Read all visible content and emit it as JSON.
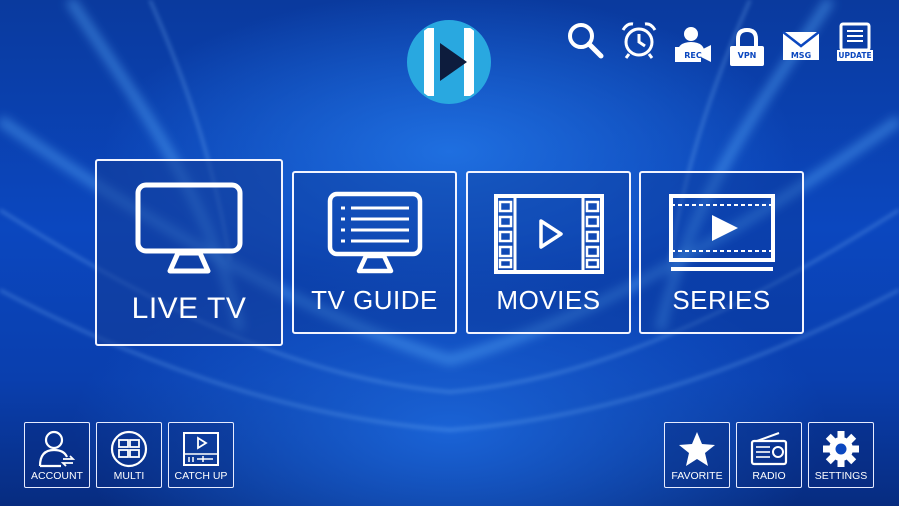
{
  "top_bar": {
    "icons": [
      {
        "name": "search-icon",
        "label": ""
      },
      {
        "name": "alarm-clock-icon",
        "label": ""
      },
      {
        "name": "record-icon",
        "label": "REC"
      },
      {
        "name": "vpn-icon",
        "label": "VPN"
      },
      {
        "name": "message-icon",
        "label": "MSG"
      },
      {
        "name": "update-icon",
        "label": "UPDATE"
      }
    ]
  },
  "main_menu": {
    "live_tv": "LIVE TV",
    "tv_guide": "TV GUIDE",
    "movies": "MOVIES",
    "series": "SERIES"
  },
  "bottom_left": {
    "account": "ACCOUNT",
    "multi": "MULTI",
    "catch_up": "CATCH UP"
  },
  "bottom_right": {
    "favorite": "FAVORITE",
    "radio": "RADIO",
    "settings": "SETTINGS"
  },
  "colors": {
    "background": "#0b47bf",
    "accent_logo": "#29a8e0",
    "foreground": "#ffffff"
  }
}
